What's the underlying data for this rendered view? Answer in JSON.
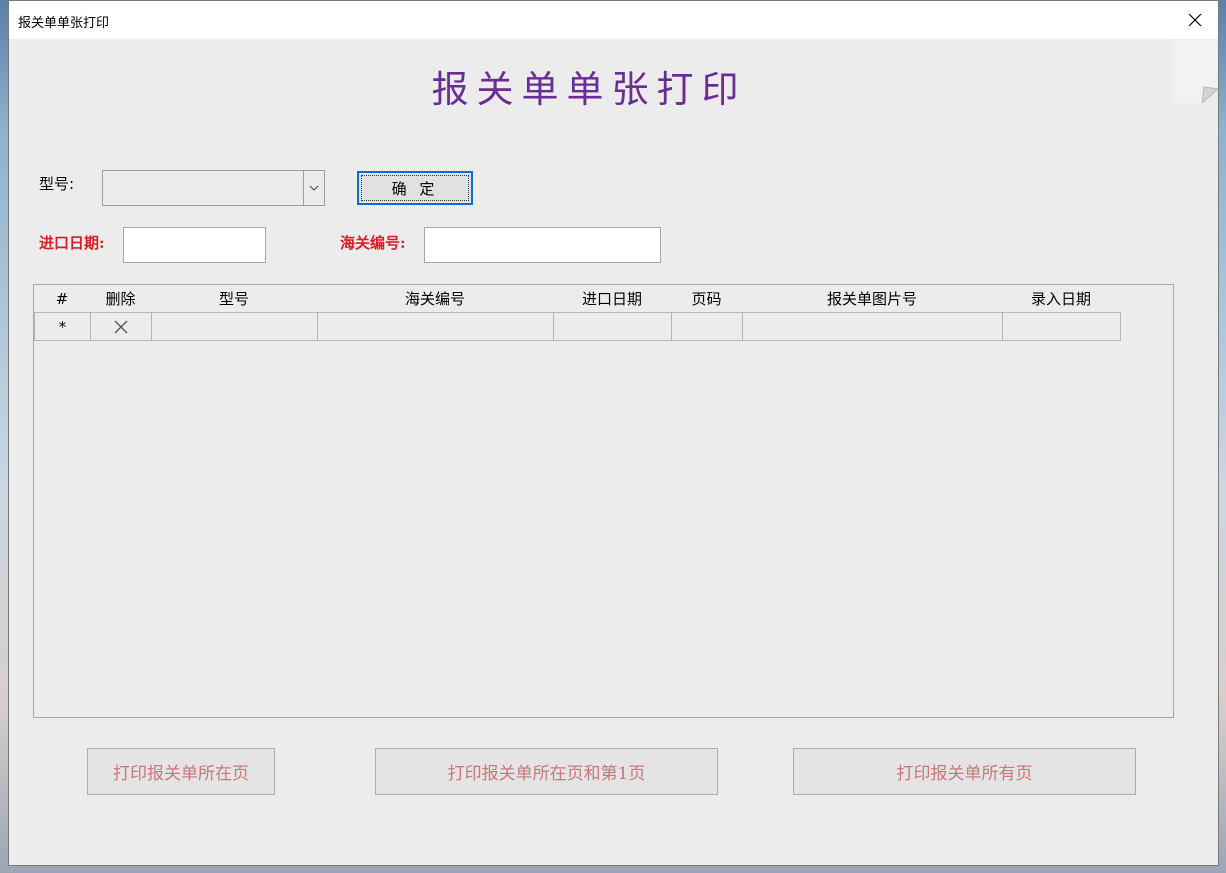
{
  "window": {
    "title": "报关单单张打印"
  },
  "heading": "报关单单张打印",
  "form": {
    "model_label": "型号:",
    "model_value": "",
    "ok_label": "确 定",
    "import_date_label": "进口日期:",
    "import_date_value": "",
    "customs_no_label": "海关编号:",
    "customs_no_value": ""
  },
  "grid": {
    "columns": [
      "#",
      "删除",
      "型号",
      "海关编号",
      "进口日期",
      "页码",
      "报关单图片号",
      "录入日期"
    ],
    "new_row_marker": "*"
  },
  "buttons": {
    "print_page": "打印报关单所在页",
    "print_page_and_first": "打印报关单所在页和第1页",
    "print_all": "打印报关单所有页"
  },
  "colors": {
    "heading": "#6a2d93",
    "red_label": "#d51f26",
    "disabled_text": "#c9777a",
    "focus": "#0f6ad6"
  }
}
